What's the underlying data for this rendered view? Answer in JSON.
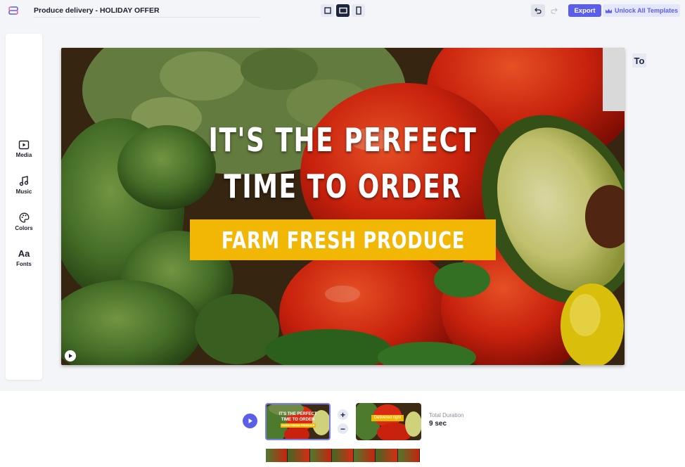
{
  "header": {
    "title": "Produce delivery - HOLIDAY OFFER",
    "export_label": "Export",
    "unlock_label": "Unlock All Templates",
    "aspect_options": [
      "square-icon",
      "landscape-icon",
      "portrait-icon"
    ],
    "active_aspect": "landscape-icon"
  },
  "sidebar": {
    "items": [
      {
        "label": "Media",
        "icon": "media-icon"
      },
      {
        "label": "Music",
        "icon": "music-icon"
      },
      {
        "label": "Colors",
        "icon": "palette-icon"
      },
      {
        "label": "Fonts",
        "icon": "fonts-icon",
        "glyph": "Aa"
      }
    ]
  },
  "canvas": {
    "headline_line1": "IT'S THE PERFECT",
    "headline_line2": "TIME TO ORDER",
    "band_text": "FARM FRESH PRODUCE",
    "text_tool_label": "To"
  },
  "timeline": {
    "scenes": [
      {
        "line1": "IT'S THE PERFECT",
        "line2": "TIME TO ORDER",
        "band": "FARM FRESH PRODUCE"
      },
      {
        "line1": "Delivered right"
      }
    ],
    "add_label": "+",
    "remove_label": "−",
    "total_duration_label": "Total Duration",
    "total_duration_value": "9 sec"
  },
  "colors": {
    "accent": "#5b5fe8",
    "band_yellow": "#f2b705",
    "dark_navy": "#1c2440"
  }
}
